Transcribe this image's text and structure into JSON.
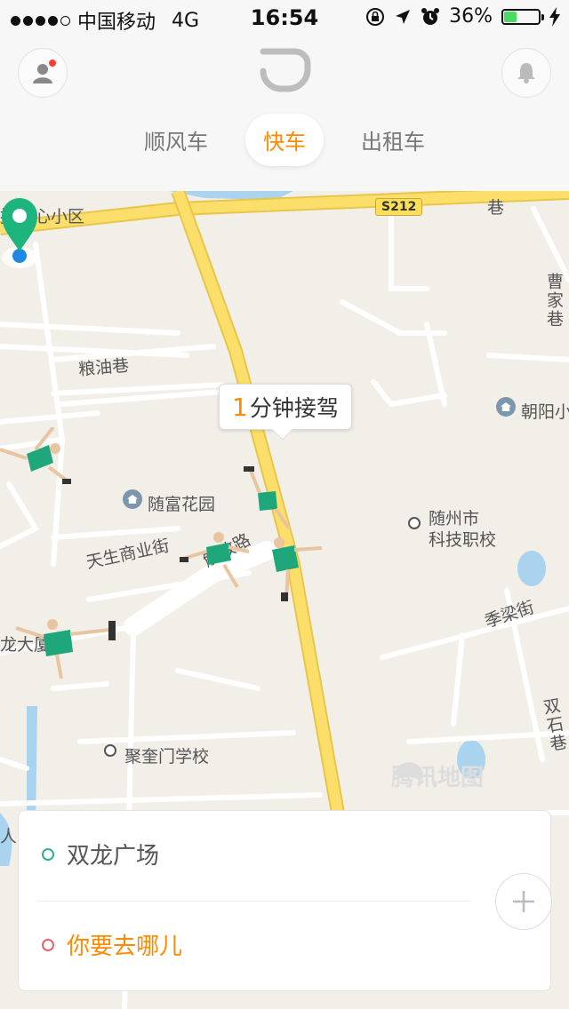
{
  "status_bar": {
    "carrier": "中国移动",
    "network": "4G",
    "time": "16:54",
    "battery_percent": "36%",
    "battery_level": 0.36,
    "signal_bars_filled": 4,
    "signal_bars_total": 5,
    "icons": [
      "orientation-lock-icon",
      "location-arrow-icon",
      "alarm-icon",
      "charging-icon"
    ]
  },
  "header": {
    "tabs": [
      {
        "label": "顺风车",
        "active": false
      },
      {
        "label": "快车",
        "active": true
      },
      {
        "label": "出租车",
        "active": false
      }
    ],
    "accent_color": "#ff8a00"
  },
  "map": {
    "eta_number": "1",
    "eta_text": "分钟接驾",
    "road_shield": "S212",
    "labels": {
      "top_left": "控中心小区",
      "xiang": "巷",
      "cao_jia_xiang": "曹家巷",
      "liang_you_xiang": "粮油巷",
      "chao_yang": "朝阳小",
      "sui_fu_garden": "随富花园",
      "suizhou_tech_1": "随州市",
      "suizhou_tech_2": "科技职校",
      "tian_sheng_street": "天生商业街",
      "road_fragment": "解放路",
      "ji_liang_street": "季梁街",
      "long_building": "龙大厦",
      "ju_kui_school": "聚奎门学校",
      "shuang_shi_xiang": "双石巷",
      "hospital_fragment": "人医"
    },
    "watermark": "腾讯地图"
  },
  "address_card": {
    "from": "双龙广场",
    "to": "你要去哪儿"
  }
}
